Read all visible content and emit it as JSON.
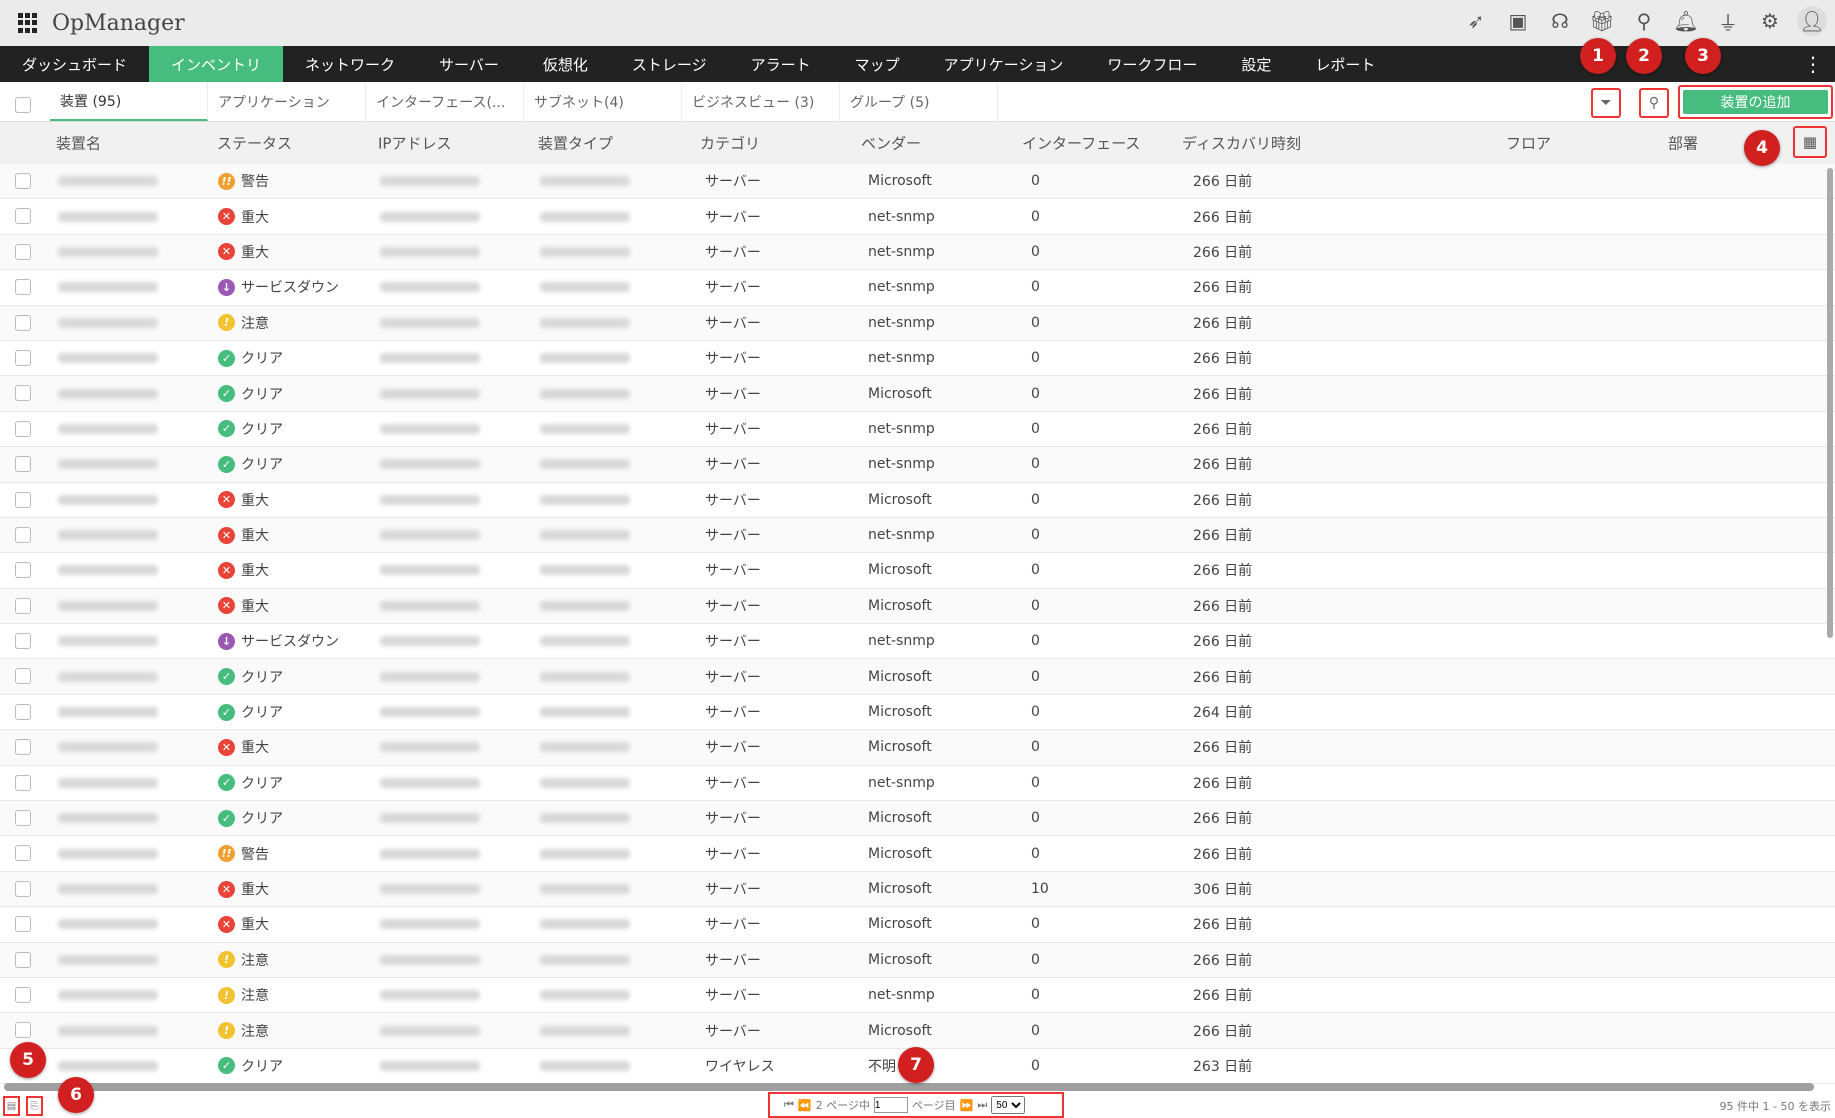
{
  "app": {
    "title": "OpManager",
    "top_icons": [
      "rocket-icon",
      "presentation-icon",
      "headset-icon",
      "gift-icon",
      "search-icon",
      "bell-icon",
      "plug-icon",
      "gear-icon",
      "user-avatar-icon"
    ]
  },
  "nav": [
    "ダッシュボード",
    "インベントリ",
    "ネットワーク",
    "サーバー",
    "仮想化",
    "ストレージ",
    "アラート",
    "マップ",
    "アプリケーション",
    "ワークフロー",
    "設定",
    "レポート"
  ],
  "subtabs": [
    "装置 (95)",
    "アプリケーション",
    "インターフェース(...",
    "サブネット(4)",
    "ビジネスビュー (3)",
    "グループ (5)"
  ],
  "add_device": "装置の追加",
  "columns": [
    "装置名",
    "ステータス",
    "IPアドレス",
    "装置タイプ",
    "カテゴリ",
    "ベンダー",
    "インターフェース",
    "ディスカバリ時刻",
    "フロア",
    "部署"
  ],
  "status_colors": {
    "警告": "#f0a030",
    "重大": "#e8443a",
    "サービスダウン": "#9b59b6",
    "注意": "#f2c230",
    "クリア": "#46bd7f"
  },
  "rows": [
    {
      "status": "警告",
      "category": "サーバー",
      "vendor": "Microsoft",
      "interfaces": "0",
      "discovered": "266 日前"
    },
    {
      "status": "重大",
      "category": "サーバー",
      "vendor": "net-snmp",
      "interfaces": "0",
      "discovered": "266 日前"
    },
    {
      "status": "重大",
      "category": "サーバー",
      "vendor": "net-snmp",
      "interfaces": "0",
      "discovered": "266 日前"
    },
    {
      "status": "サービスダウン",
      "category": "サーバー",
      "vendor": "net-snmp",
      "interfaces": "0",
      "discovered": "266 日前"
    },
    {
      "status": "注意",
      "category": "サーバー",
      "vendor": "net-snmp",
      "interfaces": "0",
      "discovered": "266 日前"
    },
    {
      "status": "クリア",
      "category": "サーバー",
      "vendor": "net-snmp",
      "interfaces": "0",
      "discovered": "266 日前"
    },
    {
      "status": "クリア",
      "category": "サーバー",
      "vendor": "Microsoft",
      "interfaces": "0",
      "discovered": "266 日前"
    },
    {
      "status": "クリア",
      "category": "サーバー",
      "vendor": "net-snmp",
      "interfaces": "0",
      "discovered": "266 日前"
    },
    {
      "status": "クリア",
      "category": "サーバー",
      "vendor": "net-snmp",
      "interfaces": "0",
      "discovered": "266 日前"
    },
    {
      "status": "重大",
      "category": "サーバー",
      "vendor": "Microsoft",
      "interfaces": "0",
      "discovered": "266 日前"
    },
    {
      "status": "重大",
      "category": "サーバー",
      "vendor": "net-snmp",
      "interfaces": "0",
      "discovered": "266 日前"
    },
    {
      "status": "重大",
      "category": "サーバー",
      "vendor": "Microsoft",
      "interfaces": "0",
      "discovered": "266 日前"
    },
    {
      "status": "重大",
      "category": "サーバー",
      "vendor": "Microsoft",
      "interfaces": "0",
      "discovered": "266 日前"
    },
    {
      "status": "サービスダウン",
      "category": "サーバー",
      "vendor": "net-snmp",
      "interfaces": "0",
      "discovered": "266 日前"
    },
    {
      "status": "クリア",
      "category": "サーバー",
      "vendor": "Microsoft",
      "interfaces": "0",
      "discovered": "266 日前"
    },
    {
      "status": "クリア",
      "category": "サーバー",
      "vendor": "Microsoft",
      "interfaces": "0",
      "discovered": "264 日前"
    },
    {
      "status": "重大",
      "category": "サーバー",
      "vendor": "Microsoft",
      "interfaces": "0",
      "discovered": "266 日前"
    },
    {
      "status": "クリア",
      "category": "サーバー",
      "vendor": "net-snmp",
      "interfaces": "0",
      "discovered": "266 日前"
    },
    {
      "status": "クリア",
      "category": "サーバー",
      "vendor": "Microsoft",
      "interfaces": "0",
      "discovered": "266 日前"
    },
    {
      "status": "警告",
      "category": "サーバー",
      "vendor": "Microsoft",
      "interfaces": "0",
      "discovered": "266 日前"
    },
    {
      "status": "重大",
      "category": "サーバー",
      "vendor": "Microsoft",
      "interfaces": "10",
      "discovered": "306 日前"
    },
    {
      "status": "重大",
      "category": "サーバー",
      "vendor": "Microsoft",
      "interfaces": "0",
      "discovered": "266 日前"
    },
    {
      "status": "注意",
      "category": "サーバー",
      "vendor": "Microsoft",
      "interfaces": "0",
      "discovered": "266 日前"
    },
    {
      "status": "注意",
      "category": "サーバー",
      "vendor": "net-snmp",
      "interfaces": "0",
      "discovered": "266 日前"
    },
    {
      "status": "注意",
      "category": "サーバー",
      "vendor": "Microsoft",
      "interfaces": "0",
      "discovered": "266 日前"
    },
    {
      "status": "クリア",
      "category": "ワイヤレス",
      "vendor": "不明",
      "interfaces": "0",
      "discovered": "263 日前"
    }
  ],
  "pager": {
    "total_pages": "2 ページ中",
    "page": "1",
    "page_suffix": "ページ目",
    "per_page": "50",
    "summary": "95 件中 1 - 50 を表示"
  },
  "annotations": [
    "1",
    "2",
    "3",
    "4",
    "5",
    "6",
    "7"
  ]
}
